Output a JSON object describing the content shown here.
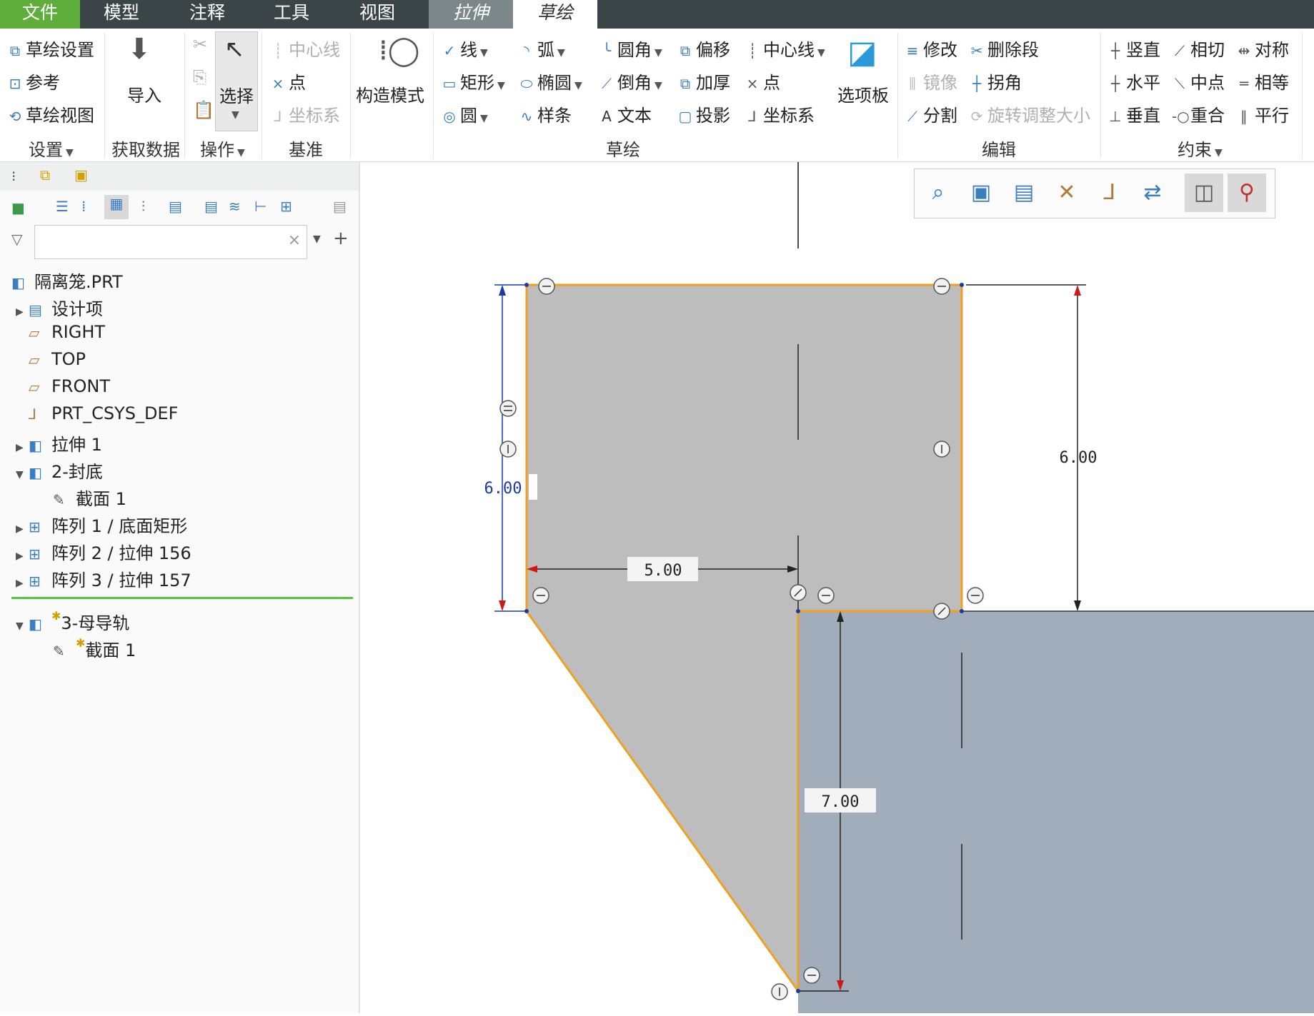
{
  "menu": {
    "file": "文件",
    "model": "模型",
    "annotate": "注释",
    "tools": "工具",
    "view": "视图",
    "extrude": "拉伸",
    "sketch": "草绘"
  },
  "ribbon": {
    "settings": {
      "sketch_setup": "草绘设置",
      "references": "参考",
      "sketch_view": "草绘视图",
      "label": "设置"
    },
    "get_data": {
      "import": "导入",
      "label": "获取数据"
    },
    "operations": {
      "select": "选择",
      "label": "操作"
    },
    "datum": {
      "centerline": "中心线",
      "point": "点",
      "csys": "坐标系",
      "label": "基准"
    },
    "construction": {
      "label": "构造模式"
    },
    "sketch": {
      "line": "线",
      "arc": "弧",
      "fillet": "圆角",
      "offset": "偏移",
      "centerline": "中心线",
      "rectangle": "矩形",
      "ellipse": "椭圆",
      "chamfer": "倒角",
      "thicken": "加厚",
      "point": "点",
      "circle": "圆",
      "spline": "样条",
      "text": "文本",
      "project": "投影",
      "csys": "坐标系",
      "label": "草绘"
    },
    "palette": {
      "label": "选项板"
    },
    "edit": {
      "modify": "修改",
      "delete_segment": "删除段",
      "mirror": "镜像",
      "corner": "拐角",
      "divide": "分割",
      "rotate_resize": "旋转调整大小",
      "label": "编辑"
    },
    "constrain": {
      "vertical": "竖直",
      "tangent": "相切",
      "symmetric": "对称",
      "horizontal": "水平",
      "midpoint": "中点",
      "equal": "相等",
      "perpendicular": "垂直",
      "coincident": "重合",
      "parallel": "平行",
      "label": "约束"
    }
  },
  "tree": {
    "root": "隔离笼.PRT",
    "items": [
      {
        "label": "设计项"
      },
      {
        "label": "RIGHT"
      },
      {
        "label": "TOP"
      },
      {
        "label": "FRONT"
      },
      {
        "label": "PRT_CSYS_DEF"
      },
      {
        "label": "拉伸 1"
      },
      {
        "label": "2-封底"
      },
      {
        "label": "截面 1"
      },
      {
        "label": "阵列 1 / 底面矩形"
      },
      {
        "label": "阵列 2 / 拉伸 156"
      },
      {
        "label": "阵列 3 / 拉伸 157"
      },
      {
        "label": "3-母导轨"
      },
      {
        "label": "截面 1"
      }
    ]
  },
  "dimensions": {
    "left_height": "6.00",
    "right_height": "6.00",
    "width": "5.00",
    "lower_height": "7.00"
  },
  "colors": {
    "menubar": "#3b4547",
    "file_tab": "#5fae3b",
    "sketch_fill": "#bdbdbd",
    "part_fill": "#a1adbb",
    "sketch_edge": "#f0a020",
    "dim_blue": "#1a3aa8"
  }
}
